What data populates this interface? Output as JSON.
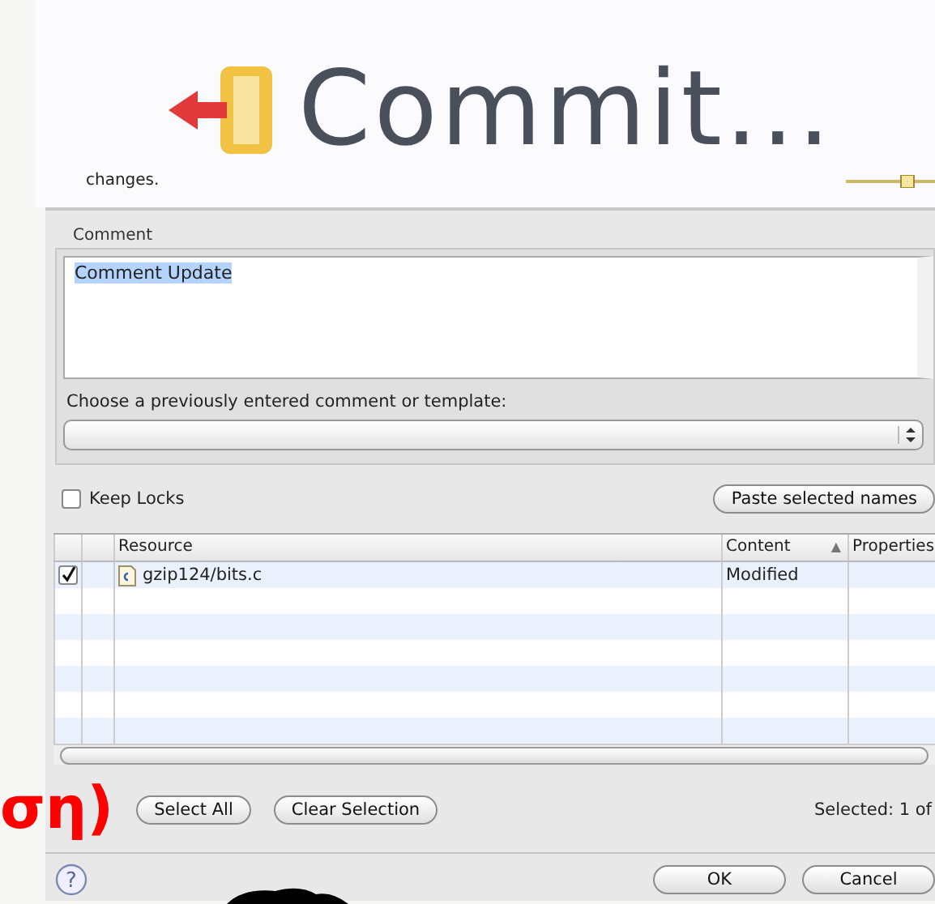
{
  "banner": {
    "title": "Commit..."
  },
  "description": "changes.",
  "comment": {
    "group_label": "Comment",
    "value": "Comment Update",
    "template_label": "Choose a previously entered comment or template:"
  },
  "keep_locks": {
    "label": "Keep Locks",
    "checked": false
  },
  "paste_button": "Paste selected names",
  "table": {
    "columns": [
      "Resource",
      "Content",
      "Properties"
    ],
    "sort_indicator": "▲",
    "rows": [
      {
        "checked": true,
        "resource": "gzip124/bits.c",
        "content": "Modified"
      }
    ]
  },
  "buttons": [
    "Select All",
    "Clear Selection"
  ],
  "selected_count": "Selected: 1 of",
  "overlay_text": "ση)",
  "help": "?",
  "dialog_buttons": [
    "OK",
    "Cancel"
  ]
}
